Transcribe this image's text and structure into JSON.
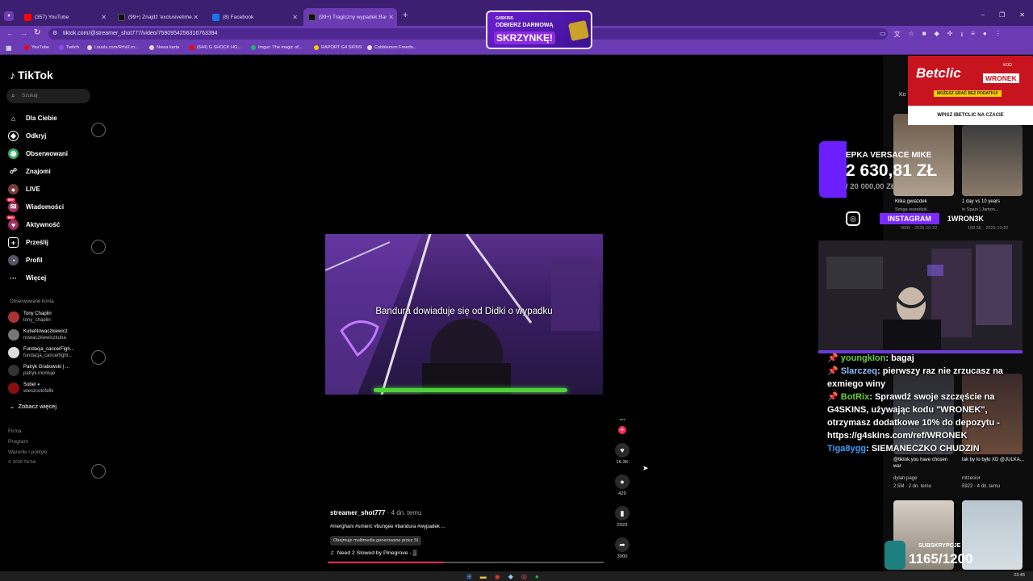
{
  "browser": {
    "tabs": [
      {
        "title": "(357) YouTube",
        "color": "#ff0000"
      },
      {
        "title": "(99+) Znajdź 'exclusivetime.krk'...",
        "color": "#111111"
      },
      {
        "title": "(8) Facebook",
        "color": "#1877f2"
      },
      {
        "title": "(99+) Tragiczny wypadek Band...",
        "color": "#111111"
      }
    ],
    "new_tab": "+",
    "url": "tiktok.com/@streamer_shot777/video/7590954256316763394",
    "bookmarks": [
      {
        "label": "YouTube",
        "color": "#ff0000"
      },
      {
        "label": "Twitch",
        "color": "#9146ff"
      },
      {
        "label": "i.nuuls.com/RrhiX.m...",
        "color": "#dddddd"
      },
      {
        "label": "Nowa karta",
        "color": "#dddddd"
      },
      {
        "label": "(644) G SHOCK HO...",
        "color": "#ff0000"
      },
      {
        "label": "Imgur: The magic of...",
        "color": "#1bb76e"
      },
      {
        "label": "RAPORT G4 SKINS",
        "color": "#ffcc00"
      },
      {
        "label": "Cobblemon Freedo...",
        "color": "#dddddd"
      }
    ]
  },
  "overlay_ad_top": {
    "brand": "G4SKINS",
    "line1": "ODBIERZ DARMOWĄ",
    "line2": "SKRZYNKĘ!"
  },
  "sidebar": {
    "logo": "TikTok",
    "search_placeholder": "Szukaj",
    "nav": [
      {
        "label": "Dla Ciebie",
        "icon": "home-icon"
      },
      {
        "label": "Odkryj",
        "icon": "compass-icon"
      },
      {
        "label": "Obserwowani",
        "icon": "following-icon"
      },
      {
        "label": "Znajomi",
        "icon": "friends-icon"
      },
      {
        "label": "LIVE",
        "icon": "live-icon"
      },
      {
        "label": "Wiadomości",
        "icon": "messages-icon",
        "badge": "99+"
      },
      {
        "label": "Aktywność",
        "icon": "activity-icon",
        "badge": "99+"
      },
      {
        "label": "Prześlij",
        "icon": "upload-icon"
      },
      {
        "label": "Profil",
        "icon": "profile-icon"
      },
      {
        "label": "Więcej",
        "icon": "more-icon"
      }
    ],
    "followed_title": "Obserwowane konta",
    "followed": [
      {
        "name": "Tony Chaplin",
        "handle": "tony_chaplin"
      },
      {
        "name": "KubaNowaczkiewicz",
        "handle": "nowaczkiewiczkuba"
      },
      {
        "name": "Fundacja_cancerFigh...",
        "handle": "fundacja_cancerfight..."
      },
      {
        "name": "Patryk Grabowski | ...",
        "handle": "patryk.montuje"
      },
      {
        "name": "Sobel",
        "handle": "wieszcotofafik"
      }
    ],
    "see_more": "Zobacz więcej",
    "footer": [
      "Firma",
      "Program",
      "Warunki i polityki",
      "© 2026 TikTok"
    ]
  },
  "video": {
    "caption": "Bandura dowiaduje się od Didki o wypadku",
    "author": "streamer_shot777",
    "time": "· 4 dn. temu",
    "hashtags": "#merghani #smierc #bungee #bandura #wypadek ...",
    "ai_label": "Obejmuje multimedia generowane przez SI",
    "music": "Need 2 Slowed by Pinegrove - ▒",
    "progress": 0.42,
    "actions": [
      {
        "icon": "heart-icon",
        "count": "16.3K"
      },
      {
        "icon": "comment-icon",
        "count": "429"
      },
      {
        "icon": "bookmark-icon",
        "count": "2023"
      },
      {
        "icon": "share-icon",
        "count": "3000"
      }
    ]
  },
  "right_column": {
    "header": "Ko",
    "thumbs": [
      {
        "title": "Kilka gwiazdek",
        "sub": "Smiga wszędzie...",
        "stats": "4085 · 2025-10-22"
      },
      {
        "title": "1 day vs 10 years",
        "sub": "in Spain | Jamon...",
        "stats": "168.5K · 2025-10-22"
      },
      {
        "title": "@tiktok you have chosen war",
        "sub": "dylan.page",
        "stats": "2.5M · 2 dn. temu"
      },
      {
        "title": "tak by to było XD @JULKA...",
        "sub": "mtzecior",
        "stats": "5922 · 4 dn. temu"
      }
    ]
  },
  "stream_overlay": {
    "betclic": {
      "brand": "Betclic",
      "kod_label": "KOD",
      "kod": "WRONEK",
      "line1": "MOŻESZ GRAĆ BEZ PODATKU!",
      "line2": "WPISZ IBETCLIC NA CZACIE"
    },
    "goal": {
      "title": "EPKA VERSACE MIKE",
      "amount": "2 630,81 ZŁ",
      "target": "/ 20 000,00 ZŁ"
    },
    "instagram": {
      "label": "INSTAGRAM",
      "handle": "1WRON3K"
    },
    "chat": [
      {
        "user": "youngkIon",
        "msg": "bagaj"
      },
      {
        "user": "Slarczeq",
        "msg": "pierwszy raz nie zrzucasz na exmiego winy"
      },
      {
        "user": "BotRix",
        "msg": "Sprawdź swoje szczęście na G4SKINS, używając kodu \"WRONEK\", otrzymasz dodatkowe 10% do depozytu - https://g4skins.com/ref/WRONEK"
      },
      {
        "user": "Tiga8ygg",
        "msg": "SIEMANECZKO CHUDZIN"
      }
    ],
    "subs": {
      "label": "SUBSKRYPCJE",
      "value": "1165/1200"
    }
  },
  "taskbar": {
    "clock": "23:45"
  },
  "colors": {
    "accent": "#6b3bb3",
    "tiktok_red": "#fe2c55",
    "chat_user": "#8ec0ff"
  }
}
